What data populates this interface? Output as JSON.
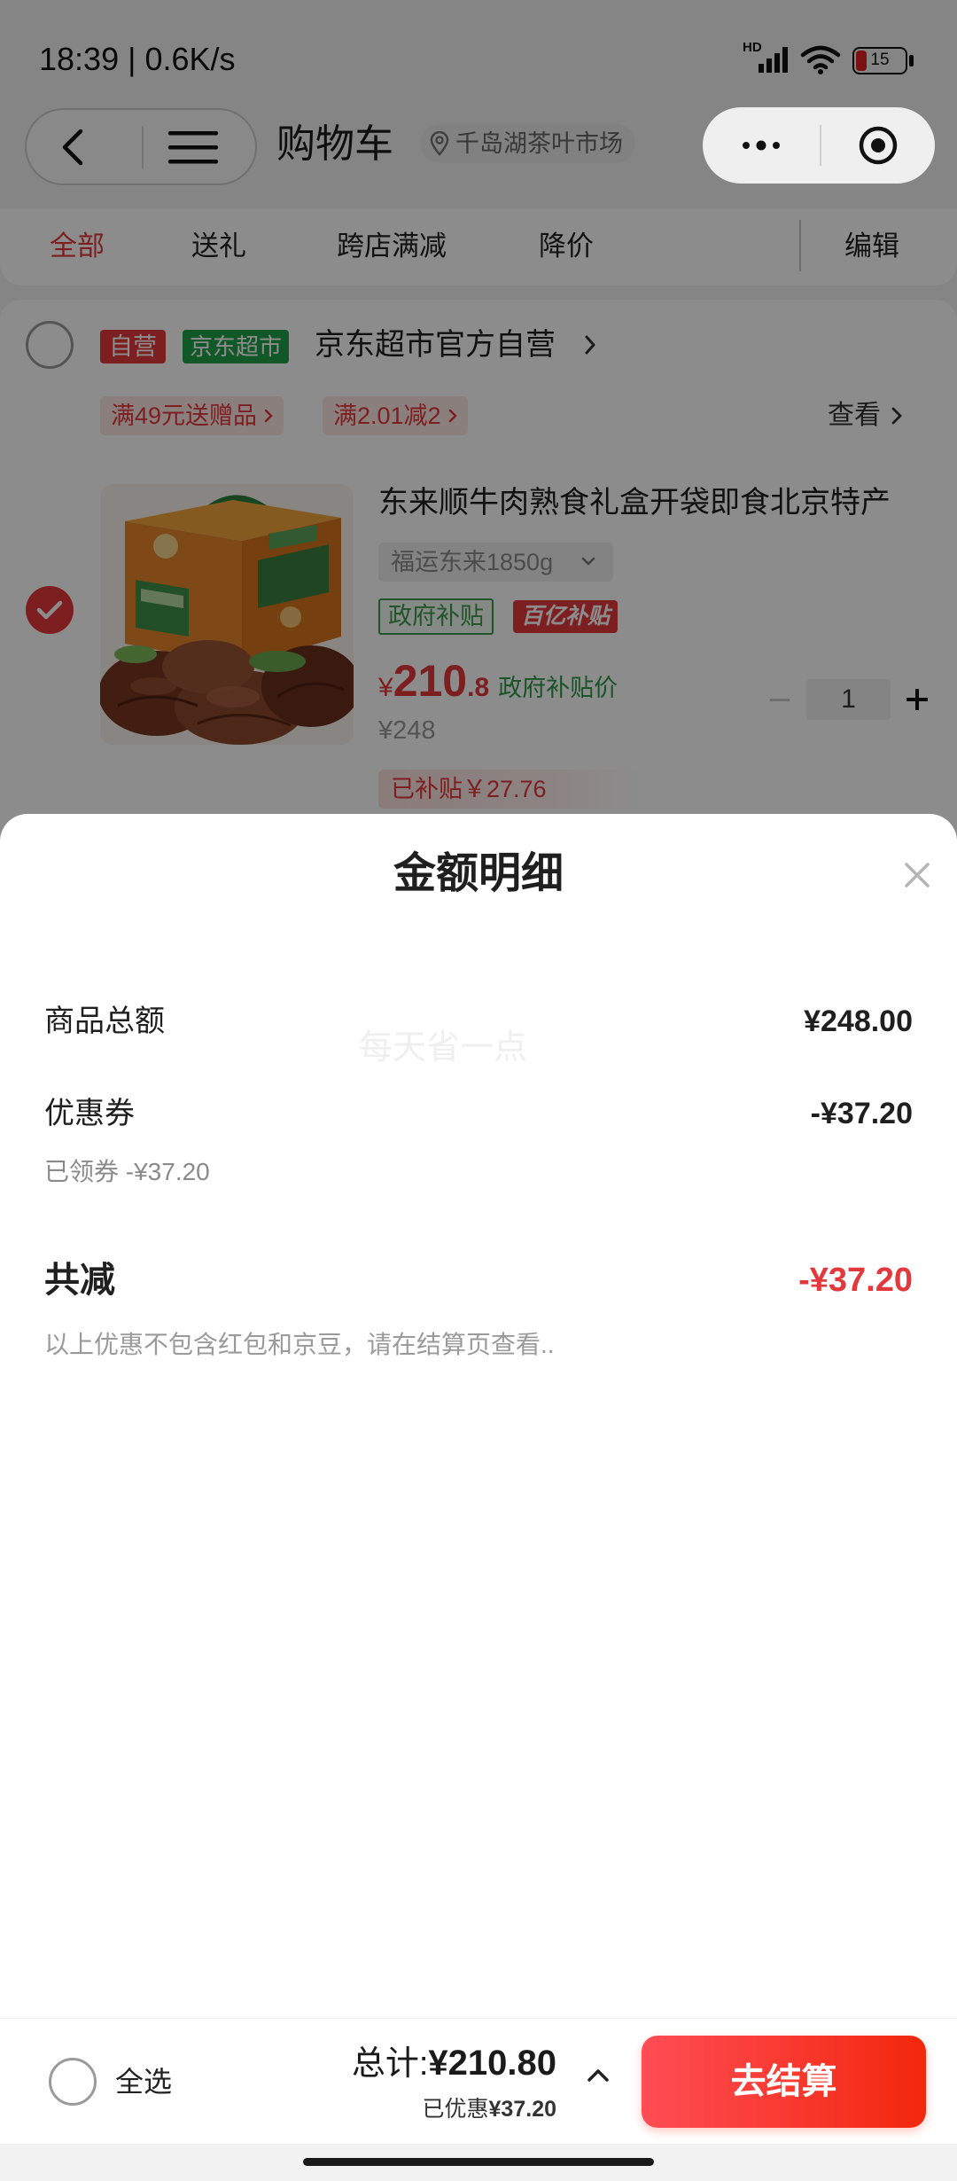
{
  "status_bar": {
    "time": "18:39 | 0.6K/s",
    "network_label": "HD",
    "battery_level": "15",
    "icons": [
      "signal-icon",
      "wifi-icon",
      "battery-icon"
    ]
  },
  "nav": {
    "title": "购物车",
    "location": "千岛湖茶叶市场",
    "icons": [
      "chevron-left-icon",
      "hamburger-icon",
      "map-pin-icon",
      "more-dots-icon",
      "target-icon"
    ]
  },
  "tabs": [
    {
      "label": "全部",
      "active": true
    },
    {
      "label": "送礼",
      "active": false
    },
    {
      "label": "跨店满减",
      "active": false
    },
    {
      "label": "降价",
      "active": false
    }
  ],
  "edit_label": "编辑",
  "store": {
    "badge_self": "自营",
    "badge_market": "京东超市",
    "name": "京东超市官方自营",
    "promos": [
      "满49元送赠品",
      "满2.01减2"
    ],
    "view_label": "查看",
    "selected": false
  },
  "product": {
    "checked": true,
    "title": "东来顺牛肉熟食礼盒开袋即食北京特产",
    "spec": "福运东来1850g",
    "tag_gov": "政府补贴",
    "tag_billion": "百亿补贴",
    "price_currency": "¥",
    "price_int": "210",
    "price_dec": ".8",
    "price_note": "政府补贴价",
    "original_price": "¥248",
    "quantity": "1",
    "subsidy": "已补贴￥27.76"
  },
  "summary_sheet": {
    "title": "金额明细",
    "watermark": "每天省一点",
    "goods_total_label": "商品总额",
    "goods_total_value": "¥248.00",
    "coupon_label": "优惠券",
    "coupon_value": "-¥37.20",
    "coupon_detail": "已领券 -¥37.20",
    "total_discount_label": "共减",
    "total_discount_value": "-¥37.20",
    "note": "以上优惠不包含红包和京豆，请在结算页查看.."
  },
  "bottom_bar": {
    "select_all_label": "全选",
    "total_label": "总计:",
    "total_value": "¥210.80",
    "saved_label": "已优惠",
    "saved_value": "¥37.20",
    "checkout_label": "去结算"
  },
  "colors": {
    "accent": "#e4393c",
    "checkout": "#f2270c",
    "market_green": "#1fa14c",
    "subsidy_green": "#3c9a4c"
  }
}
